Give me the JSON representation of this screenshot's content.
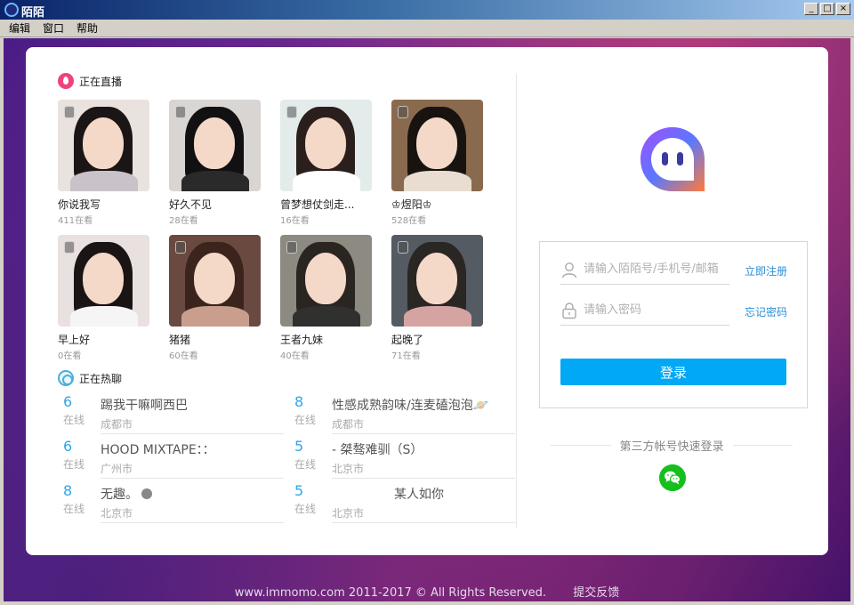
{
  "window": {
    "title": "陌陌",
    "controls": [
      "_",
      "□",
      "×"
    ]
  },
  "menu": [
    "编辑",
    "窗口",
    "帮助"
  ],
  "live": {
    "heading": "正在直播",
    "items": [
      {
        "name": "你说我写",
        "count": "411在看",
        "bg": "#e9e2df",
        "hair": "#1c1515",
        "body": "#c9c2c8"
      },
      {
        "name": "好久不见",
        "count": "28在看",
        "bg": "#d9d5d3",
        "hair": "#111",
        "body": "#2a2a2a"
      },
      {
        "name": "曾梦想仗剑走...",
        "count": "16在看",
        "bg": "#e4ebeb",
        "hair": "#2a1f1c",
        "body": "#ffffff"
      },
      {
        "name": "♔煜阳♔",
        "count": "528在看",
        "bg": "#8a6a4e",
        "hair": "#191310",
        "body": "#e8ddd0"
      },
      {
        "name": "早上好",
        "count": "0在看",
        "bg": "#e9e1df",
        "hair": "#1b1414",
        "body": "#f5f5f5"
      },
      {
        "name": "猪猪",
        "count": "60在看",
        "bg": "#6a4a40",
        "hair": "#3b241c",
        "body": "#c99e8d"
      },
      {
        "name": "王者九妹",
        "count": "40在看",
        "bg": "#8d8a82",
        "hair": "#2b2522",
        "body": "#30302f"
      },
      {
        "name": "起晚了",
        "count": "71在看",
        "bg": "#555b63",
        "hair": "#2a2624",
        "body": "#d6a3a3"
      }
    ]
  },
  "chats": {
    "heading": "正在热聊",
    "online_label": "在线",
    "items": [
      {
        "num": "6",
        "title": "踢我干嘛啊西巴",
        "city": "成都市"
      },
      {
        "num": "8",
        "title": "性感成熟韵味/连麦磕泡泡🪐",
        "city": "成都市"
      },
      {
        "num": "6",
        "title": "HOOD MIXTAPE：：",
        "city": "广州市"
      },
      {
        "num": "5",
        "title": "- 桀骜难驯（S）",
        "city": "北京市"
      },
      {
        "num": "8",
        "title": "无趣。",
        "city": "北京市",
        "dot": true
      },
      {
        "num": "5",
        "title": "　　　　　某人如你",
        "city": "北京市"
      }
    ]
  },
  "login": {
    "username_placeholder": "请输入陌陌号/手机号/邮箱",
    "password_placeholder": "请输入密码",
    "register_link": "立即注册",
    "forgot_link": "忘记密码",
    "submit": "登录",
    "third_party": "第三方帐号快速登录",
    "wechat_icon": "wechat-icon"
  },
  "footer": {
    "copyright": "www.immomo.com 2011-2017 © All Rights Reserved.",
    "feedback": "提交反馈"
  },
  "colors": {
    "accent": "#00a8f5",
    "live": "#f0427c",
    "link": "#2a8fd8",
    "wechat": "#15bf1e"
  }
}
